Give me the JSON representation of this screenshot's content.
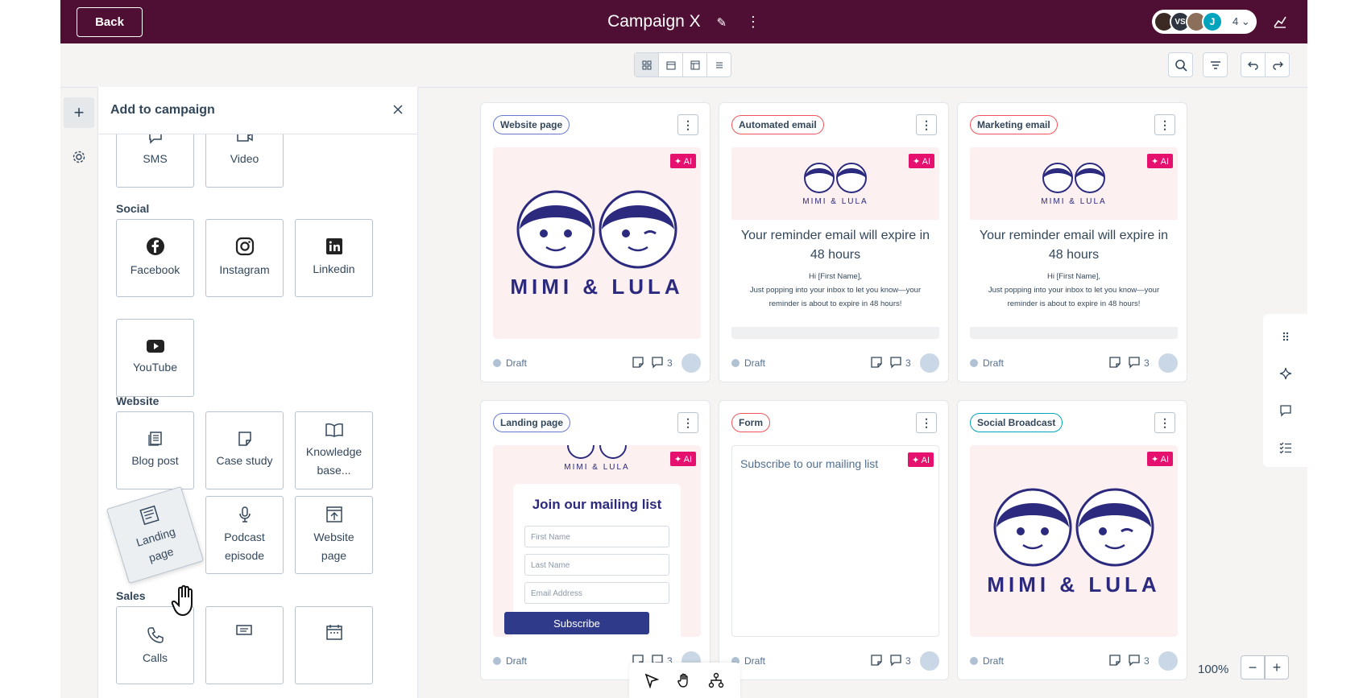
{
  "header": {
    "back_label": "Back",
    "title": "Campaign X",
    "collaborator_initials": [
      "VS",
      "J"
    ],
    "collaborator_count": "4",
    "brand_color": "#4f0e33"
  },
  "toolbar": {
    "view_modes": [
      "grid-view-icon",
      "calendar-view-icon",
      "table-view-icon",
      "list-view-icon"
    ],
    "active_view": "grid-view-icon",
    "tools": [
      "search-icon",
      "filter-icon",
      "undo-icon",
      "redo-icon"
    ]
  },
  "panel": {
    "title": "Add to campaign",
    "partial_tiles": [
      "SMS",
      "Video"
    ],
    "social_heading": "Social",
    "social_tiles": [
      "Facebook",
      "Instagram",
      "Linkedin",
      "YouTube"
    ],
    "website_heading": "Website",
    "website_tiles": [
      "Blog post",
      "Case study",
      "Knowledge base...",
      "Landing page",
      "Podcast episode",
      "Website page"
    ],
    "sales_heading": "Sales",
    "sales_tiles": [
      "Calls"
    ]
  },
  "cards": [
    {
      "tag": "Website page",
      "tag_color": "#6a78d1",
      "status": "Draft",
      "comments": "3",
      "ai": "✦ AI",
      "brand": "MIMI & LULA"
    },
    {
      "tag": "Automated email",
      "tag_color": "#f2545b",
      "status": "Draft",
      "comments": "3",
      "ai": "✦ AI",
      "brand": "MIMI & LULA",
      "email_title": "Your reminder email will expire in 48 hours",
      "email_greeting": "Hi [First Name],",
      "email_text": "Just popping into your inbox to let you know—your reminder is about to expire in 48 hours!"
    },
    {
      "tag": "Marketing email",
      "tag_color": "#f2545b",
      "status": "Draft",
      "comments": "3",
      "ai": "✦ AI",
      "brand": "MIMI & LULA",
      "email_title": "Your reminder email will expire in 48 hours",
      "email_greeting": "Hi [First Name],",
      "email_text": "Just popping into your inbox to let you know—your reminder is about to expire in 48 hours!"
    },
    {
      "tag": "Landing page",
      "tag_color": "#6a78d1",
      "status": "Draft",
      "comments": "3",
      "ai": "✦ AI",
      "brand": "MIMI & LULA",
      "form_title": "Join our mailing list",
      "fields": [
        "First Name",
        "Last Name",
        "Email Address"
      ],
      "submit": "Subscribe"
    },
    {
      "tag": "Form",
      "tag_color": "#f2545b",
      "status": "Draft",
      "comments": "3",
      "ai": "✦ AI",
      "form_text": "Subscribe to our mailing list"
    },
    {
      "tag": "Social Broadcast",
      "tag_color": "#00a4bd",
      "status": "Draft",
      "comments": "3",
      "ai": "✦ AI",
      "brand": "MIMI & LULA"
    }
  ],
  "canvas": {
    "zoom": "100%",
    "zoom_out": "−",
    "zoom_in": "+"
  }
}
